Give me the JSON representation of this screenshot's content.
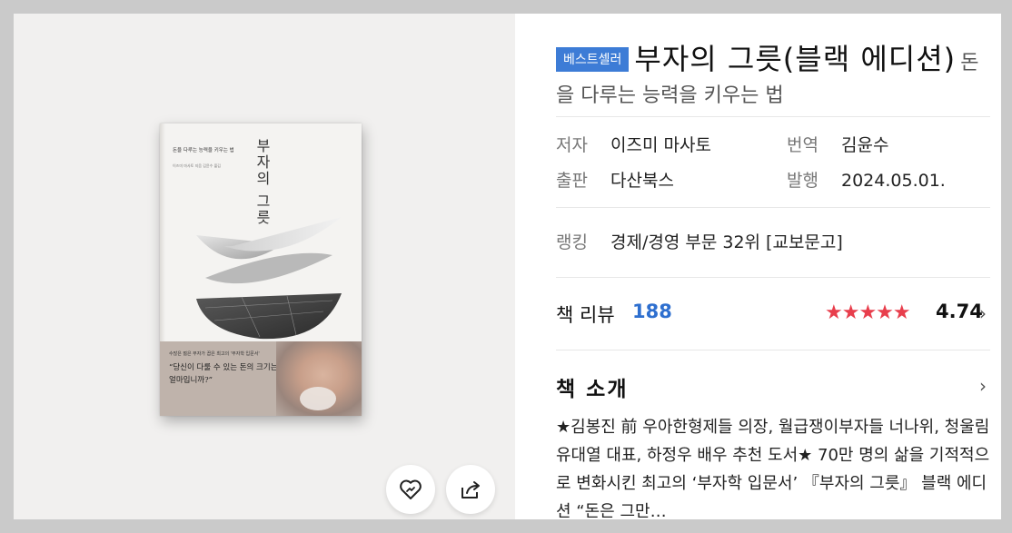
{
  "badge": "베스트셀러",
  "title": "부자의 그릇(블랙 에디션)",
  "subtitle": "돈을 다루는 능력을 키우는 법",
  "meta": {
    "author_label": "저자",
    "author": "이즈미 마사토",
    "translator_label": "번역",
    "translator": "김윤수",
    "publisher_label": "출판",
    "publisher": "다산북스",
    "date_label": "발행",
    "date": "2024.05.01.",
    "ranking_label": "랭킹",
    "ranking": "경제/경영 부문 32위 [교보문고]"
  },
  "review": {
    "label": "책 리뷰",
    "count": "188",
    "stars": "★★★★★",
    "rating": "4.74",
    "rating_value": 4.74
  },
  "intro": {
    "title": "책 소개",
    "text": "★김봉진 前 우아한형제들 의장, 월급쟁이부자들 너나위, 청울림 유대열 대표, 하정우 배우 추천 도서★ 70만 명의 삶을 기적적으로 변화시킨 최고의 ‘부자학 입문서’ 『부자의 그릇』 블랙 에디션 “돈은 그만…"
  },
  "cover": {
    "tagline": "돈을 다루는 능력을 키우는 법",
    "credits": "이즈미 마사토 지음 김윤수 옮김",
    "vertical_title": "부자의 그릇",
    "band_line1": "수많은 젊은 부자가 꼽은 최고의 '부자학 입문서'",
    "band_line2": "“당신이 다룰 수 있는 돈의 크기는 얼마입니까?”"
  },
  "icons": {
    "like": "heart-icon",
    "share": "share-icon",
    "chevron": "chevron-right-icon"
  },
  "colors": {
    "badge": "#3d7cd6",
    "review_count": "#2e6fcf",
    "stars": "#e83e4c"
  }
}
